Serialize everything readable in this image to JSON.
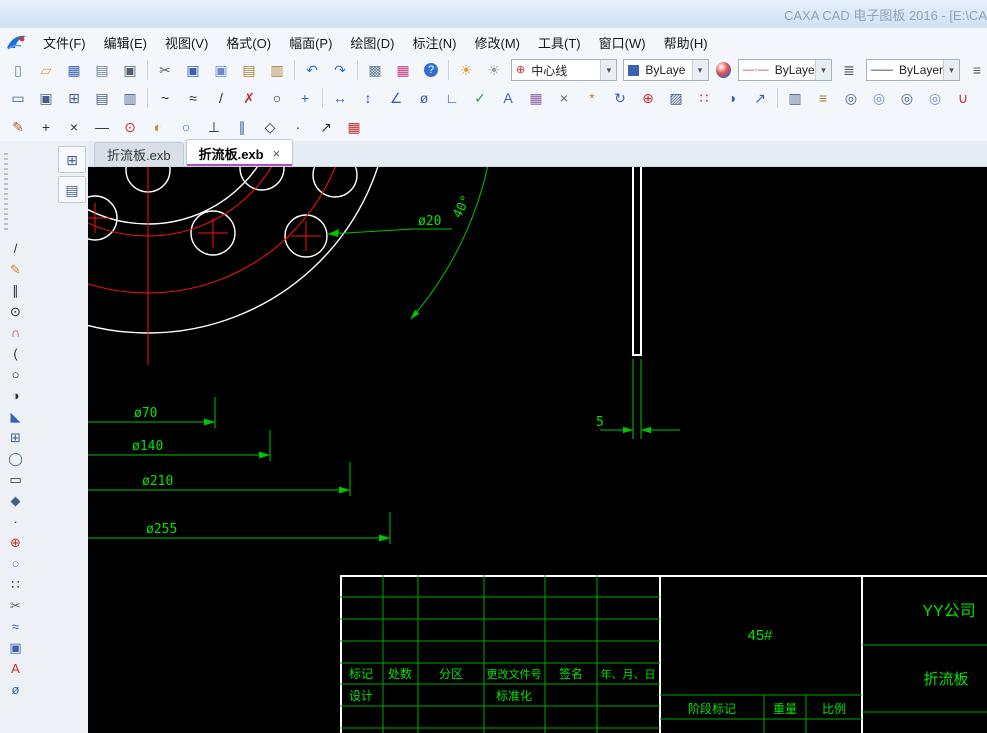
{
  "ui": {
    "dropdown_arrow": "▾",
    "tab_close": "×"
  },
  "window": {
    "title": "CAXA CAD 电子图板 2016 - [E:\\CA"
  },
  "menubar": {
    "items": [
      "文件(F)",
      "编辑(E)",
      "视图(V)",
      "格式(O)",
      "幅面(P)",
      "绘图(D)",
      "标注(N)",
      "修改(M)",
      "工具(T)",
      "窗口(W)",
      "帮助(H)"
    ]
  },
  "toolbar1": {
    "icons_left": [
      {
        "n": "new-file",
        "g": "▯",
        "c": "#667f99"
      },
      {
        "n": "open-file",
        "g": "▱",
        "c": "#d9a33b"
      },
      {
        "n": "save-file",
        "g": "▦",
        "c": "#3a62b0"
      },
      {
        "n": "plot-preview",
        "g": "▤",
        "c": "#667f99"
      },
      {
        "n": "print",
        "g": "▣",
        "c": "#556070"
      },
      {
        "sep": true
      },
      {
        "n": "cut",
        "g": "✂",
        "c": "#556070"
      },
      {
        "n": "copy",
        "g": "▣",
        "c": "#3a62b0"
      },
      {
        "n": "copy-with-basepoint",
        "g": "▣",
        "c": "#6a8cc8"
      },
      {
        "n": "paste",
        "g": "▤",
        "c": "#b08030"
      },
      {
        "n": "paste-special",
        "g": "▥",
        "c": "#b08030"
      },
      {
        "sep": true
      },
      {
        "n": "undo",
        "g": "↶",
        "c": "#2f6fd0"
      },
      {
        "n": "redo",
        "g": "↷",
        "c": "#2f6fd0"
      },
      {
        "sep": true
      },
      {
        "n": "ole-object",
        "g": "▩",
        "c": "#667f99"
      },
      {
        "n": "insert-bitmap",
        "g": "▦",
        "c": "#c04080"
      },
      {
        "n": "help",
        "g": "?",
        "c": "#ffffff",
        "bg": "#2f6fd0"
      },
      {
        "sep": true
      },
      {
        "n": "layer-on",
        "g": "☀",
        "c": "#e0a018"
      },
      {
        "n": "layer-color",
        "g": "☀",
        "c": "#98a0ac"
      }
    ],
    "icons_mid": [
      {
        "n": "linewidth-list",
        "g": "≣",
        "c": "#556070"
      }
    ],
    "icons_end": [
      {
        "n": "linewidth-settings",
        "g": "≡",
        "c": "#556070"
      }
    ],
    "centerline_glyph": "⊕",
    "linetype_glyph": "—·—",
    "linewidth_glyph": "——",
    "layer_color": "#3a62b0",
    "combos": {
      "centerline": "中心线",
      "layer": "ByLaye",
      "linetype": "ByLaye",
      "linewidth": "ByLayer"
    }
  },
  "toolbar2": {
    "icons": [
      {
        "n": "paper-setup",
        "g": "▭",
        "c": "#44608a"
      },
      {
        "n": "title-block",
        "g": "▣",
        "c": "#44608a"
      },
      {
        "n": "parameter-bar",
        "g": "⊞",
        "c": "#44608a"
      },
      {
        "n": "bom-table",
        "g": "▤",
        "c": "#44608a"
      },
      {
        "n": "sheet-number",
        "g": "▥",
        "c": "#44608a"
      },
      {
        "sep": true
      },
      {
        "n": "spline",
        "g": "~",
        "c": "#2a2f38"
      },
      {
        "n": "curve",
        "g": "≈",
        "c": "#2a2f38"
      },
      {
        "n": "line",
        "g": "/",
        "c": "#2a2f38"
      },
      {
        "n": "erase",
        "g": "✗",
        "c": "#c03030"
      },
      {
        "n": "circle",
        "g": "○",
        "c": "#2a2f38"
      },
      {
        "n": "pan",
        "g": "+",
        "c": "#3a62b0"
      },
      {
        "sep": true
      },
      {
        "n": "dim-linear",
        "g": "↔",
        "c": "#3a62b0"
      },
      {
        "n": "dim-vertical",
        "g": "↕",
        "c": "#3a62b0"
      },
      {
        "n": "dim-angular",
        "g": "∠",
        "c": "#3a62b0"
      },
      {
        "n": "dim-diameter",
        "g": "ø",
        "c": "#3a62b0"
      },
      {
        "n": "dim-coordinate",
        "g": "∟",
        "c": "#3a62b0"
      },
      {
        "n": "dim-check",
        "g": "✓",
        "c": "#2f9f3f"
      },
      {
        "n": "annotate-text",
        "g": "A",
        "c": "#3a62b0"
      },
      {
        "n": "insert-image",
        "g": "▦",
        "c": "#8a62b0"
      },
      {
        "n": "break",
        "g": "×",
        "c": "#556070"
      },
      {
        "n": "explode",
        "g": "*",
        "c": "#d08030"
      },
      {
        "n": "rotate",
        "g": "↻",
        "c": "#3a62b0"
      },
      {
        "n": "center-mark",
        "g": "⊕",
        "c": "#c03030"
      },
      {
        "n": "hatch",
        "g": "▨",
        "c": "#44608a"
      },
      {
        "n": "array",
        "g": "∷",
        "c": "#c03030"
      },
      {
        "n": "render-sphere",
        "g": "◑",
        "c": "#3a62b0"
      },
      {
        "n": "leader",
        "g": "↗",
        "c": "#3a62b0"
      },
      {
        "sep": true
      },
      {
        "n": "properties-panel",
        "g": "▥",
        "c": "#44608a"
      },
      {
        "n": "ruler",
        "g": "≡",
        "c": "#b08030"
      },
      {
        "n": "zoom-window",
        "g": "◎",
        "c": "#44608a"
      },
      {
        "n": "zoom-pan",
        "g": "◎",
        "c": "#6a8cc8"
      },
      {
        "n": "zoom-in",
        "g": "◎",
        "c": "#44608a"
      },
      {
        "n": "zoom-out",
        "g": "◎",
        "c": "#6a8cc8"
      },
      {
        "n": "object-snap",
        "g": "∪",
        "c": "#c03030"
      },
      {
        "n": "quick-dim",
        "g": "↯",
        "c": "#d0a020"
      },
      {
        "n": "pen-edit",
        "g": "✎",
        "c": "#d08030"
      },
      {
        "n": "pen-color",
        "g": "✎",
        "c": "#c03030"
      }
    ]
  },
  "toolbar3": {
    "icons": [
      {
        "n": "sketch-pen",
        "g": "✎",
        "c": "#b06030"
      },
      {
        "n": "snap-endpoint",
        "g": "+",
        "c": "#2a2f38"
      },
      {
        "n": "snap-intersection",
        "g": "×",
        "c": "#2a2f38"
      },
      {
        "n": "snap-nearest",
        "g": "—",
        "c": "#2a2f38"
      },
      {
        "n": "snap-center",
        "g": "⊙",
        "c": "#c03030"
      },
      {
        "n": "snap-quadrant",
        "g": "◐",
        "c": "#d08030"
      },
      {
        "n": "snap-tangent",
        "g": "○",
        "c": "#3a62b0"
      },
      {
        "n": "snap-perpendicular",
        "g": "⊥",
        "c": "#2a2f38"
      },
      {
        "n": "snap-parallel",
        "g": "∥",
        "c": "#3a62b0"
      },
      {
        "n": "snap-node",
        "g": "◇",
        "c": "#2a2f38"
      },
      {
        "n": "snap-point",
        "g": "·",
        "c": "#2a2f38"
      },
      {
        "n": "snap-extension",
        "g": "↗",
        "c": "#2a2f38"
      },
      {
        "n": "grid-settings",
        "g": "▦",
        "c": "#c03030"
      }
    ]
  },
  "dock": {
    "palette_icons": [
      {
        "n": "sheet-panel",
        "g": "⊞",
        "c": "#44608a"
      },
      {
        "n": "drawing-panel",
        "g": "▤",
        "c": "#44608a"
      }
    ],
    "tool_icons": [
      {
        "n": "draw-line",
        "g": "/",
        "c": "#2a2f38"
      },
      {
        "n": "draw-sketch",
        "g": "✎",
        "c": "#d08030"
      },
      {
        "n": "draw-parallel",
        "g": "∥",
        "c": "#2a2f38"
      },
      {
        "n": "draw-circle",
        "g": "⊙",
        "c": "#2a2f38"
      },
      {
        "n": "draw-arc",
        "g": "∩",
        "c": "#c04080"
      },
      {
        "n": "draw-arc-3p",
        "g": "(",
        "c": "#2a2f38"
      },
      {
        "n": "draw-circle-2p",
        "g": "○",
        "c": "#2a2f38"
      },
      {
        "n": "draw-ellipse-arc",
        "g": "◑",
        "c": "#2a2f38"
      },
      {
        "n": "draw-polyline",
        "g": "◣",
        "c": "#3a62b0"
      },
      {
        "n": "draw-grid",
        "g": "⊞",
        "c": "#44608a"
      },
      {
        "n": "draw-ellipse",
        "g": "◯",
        "c": "#44608a"
      },
      {
        "n": "draw-rectangle",
        "g": "▭",
        "c": "#2a2f38"
      },
      {
        "n": "draw-polygon",
        "g": "◆",
        "c": "#44608a"
      },
      {
        "n": "draw-point",
        "g": "·",
        "c": "#2a2f38"
      },
      {
        "n": "draw-centerline",
        "g": "⊕",
        "c": "#c03030"
      },
      {
        "n": "draw-offset",
        "g": "○",
        "c": "#8a62b0"
      },
      {
        "n": "draw-points",
        "g": "∷",
        "c": "#2a2f38"
      },
      {
        "n": "trim",
        "g": "✂",
        "c": "#556070"
      },
      {
        "n": "draw-wave-line",
        "g": "≈",
        "c": "#3a62b0"
      },
      {
        "n": "copy-object",
        "g": "▣",
        "c": "#3a62b0"
      },
      {
        "n": "draw-text",
        "g": "A",
        "c": "#c03030"
      },
      {
        "n": "draw-dimension",
        "g": "ø",
        "c": "#3a62b0"
      }
    ]
  },
  "tabs": {
    "items": [
      {
        "label": "折流板.exb",
        "active": false
      },
      {
        "label": "折流板.exb",
        "active": true
      }
    ]
  },
  "canvas": {
    "dims": {
      "d20": "ø20",
      "a40": "40°",
      "d70": "ø70",
      "d140": "ø140",
      "d210": "ø210",
      "d255": "ø255",
      "t5": "5"
    },
    "colors": {
      "geometry": "#ffffff",
      "centerline": "#ff1010",
      "dimension": "#00c400",
      "background": "#000000"
    }
  },
  "title_block": {
    "headers": [
      "标记",
      "处数",
      "分区",
      "更改文件号",
      "签名",
      "年、月、日"
    ],
    "row2": {
      "design": "设计",
      "standardization": "标准化"
    },
    "material": "45#",
    "stage_label": "阶段标记",
    "weight_label": "重量",
    "scale_label": "比例",
    "company": "YY公司",
    "part_name": "折流板"
  }
}
